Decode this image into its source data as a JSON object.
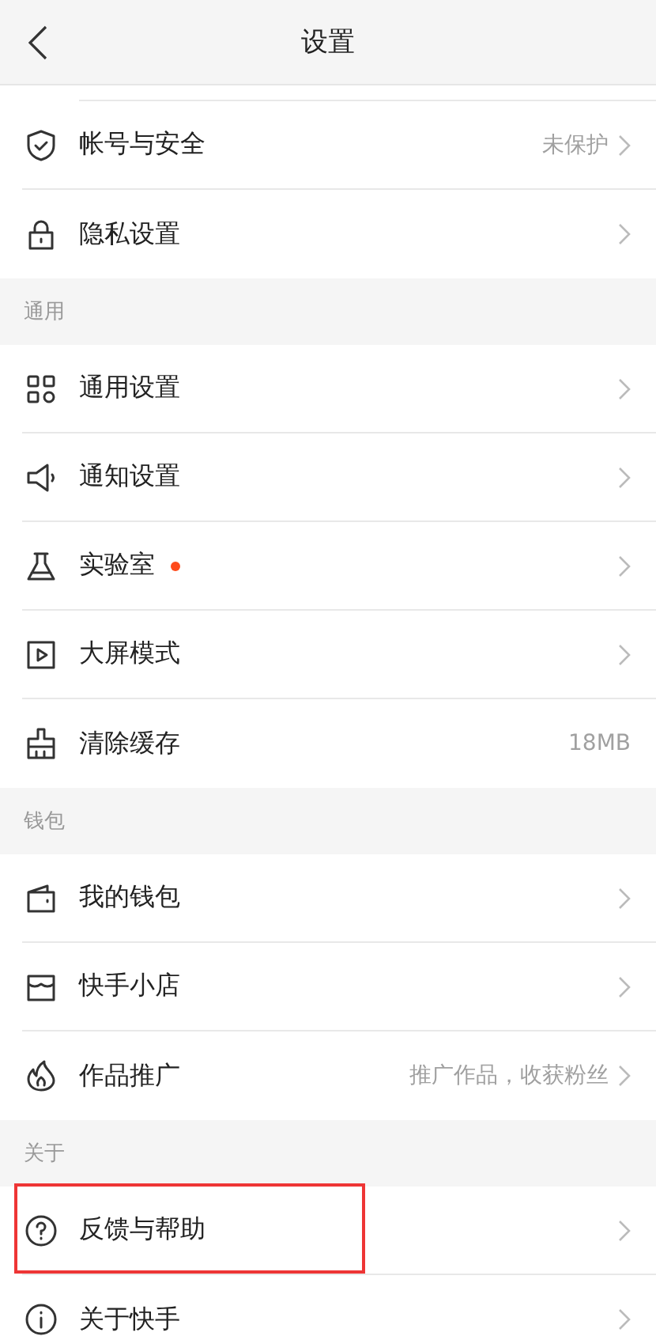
{
  "header": {
    "title": "设置",
    "back": true
  },
  "sections": [
    {
      "items": [
        {
          "kind": "shield",
          "label": "帐号与安全",
          "value": "未保护",
          "dot": false,
          "highlighted": false
        },
        {
          "kind": "lock",
          "label": "隐私设置",
          "dot": false,
          "highlighted": false
        }
      ]
    },
    {
      "title": "通用",
      "items": [
        {
          "kind": "grid",
          "label": "通用设置",
          "dot": false,
          "highlighted": false
        },
        {
          "kind": "speaker",
          "label": "通知设置",
          "dot": false,
          "highlighted": false
        },
        {
          "kind": "flask",
          "label": "实验室",
          "dot": true,
          "highlighted": false
        },
        {
          "kind": "play",
          "label": "大屏模式",
          "dot": false,
          "highlighted": false
        },
        {
          "kind": "brush",
          "label": "清除缓存",
          "value": "18MB",
          "chevron": false,
          "dot": false,
          "highlighted": false
        }
      ]
    },
    {
      "title": "钱包",
      "items": [
        {
          "kind": "wallet",
          "label": "我的钱包",
          "dot": false,
          "highlighted": false
        },
        {
          "kind": "shop",
          "label": "快手小店",
          "dot": false,
          "highlighted": false
        },
        {
          "kind": "flame",
          "label": "作品推广",
          "value": "推广作品，收获粉丝",
          "dot": false,
          "highlighted": false
        }
      ]
    },
    {
      "title": "关于",
      "items": [
        {
          "kind": "help",
          "label": "反馈与帮助",
          "dot": false,
          "highlighted": true
        },
        {
          "kind": "info",
          "label": "关于快手",
          "dot": false,
          "highlighted": false
        }
      ]
    }
  ]
}
